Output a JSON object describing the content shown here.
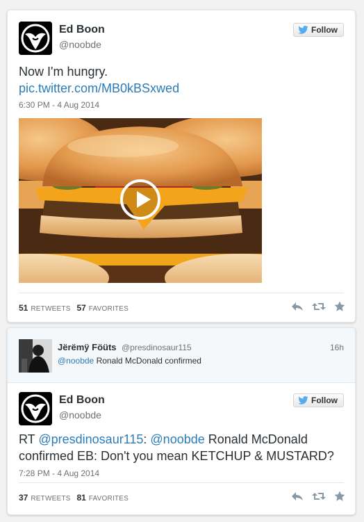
{
  "tweet1": {
    "author_name": "Ed Boon",
    "author_handle": "@noobde",
    "follow_label": "Follow",
    "text_line": "Now I'm hungry.",
    "text_link": "pic.twitter.com/MB0kBSxwed",
    "timestamp": "6:30 PM - 4 Aug 2014",
    "retweets_count": "51",
    "retweets_label": "RETWEETS",
    "favorites_count": "57",
    "favorites_label": "FAVORITES"
  },
  "quoted": {
    "author_name": "Jërëmÿ Föüts",
    "author_handle": "@presdinosaur115",
    "time_ago": "16h",
    "mention": "@noobde",
    "text": " Ronald McDonald confirmed"
  },
  "tweet2": {
    "author_name": "Ed Boon",
    "author_handle": "@noobde",
    "follow_label": "Follow",
    "text_prefix": "RT ",
    "mention1": "@presdinosaur115",
    "colon": ": ",
    "mention2": "@noobde",
    "text_rest1": " Ronald McDonald",
    "text_line2": "confirmed EB: Don't you mean KETCHUP & MUSTARD?",
    "timestamp": "7:28 PM - 4 Aug 2014",
    "retweets_count": "37",
    "retweets_label": "RETWEETS",
    "favorites_count": "81",
    "favorites_label": "FAVORITES"
  },
  "icons": {
    "reply": "reply-icon",
    "retweet": "retweet-icon",
    "favorite": "star-icon",
    "bird": "twitter-bird-icon",
    "play": "play-icon"
  },
  "colors": {
    "link": "#2b7bb9",
    "bird": "#55acee",
    "muted": "#707070",
    "action_icon": "#8899a6"
  }
}
